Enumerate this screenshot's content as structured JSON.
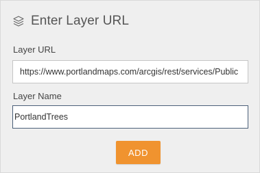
{
  "panel": {
    "title": "Enter Layer URL",
    "header_icon": "layers-icon"
  },
  "layer_url": {
    "label": "Layer URL",
    "value": "https://www.portlandmaps.com/arcgis/rest/services/Public"
  },
  "layer_name": {
    "label": "Layer Name",
    "value": "PortlandTrees"
  },
  "actions": {
    "add_label": "ADD"
  },
  "colors": {
    "accent": "#f0932f",
    "panel_bg": "#efefef",
    "focus_border": "#4a5f78"
  }
}
